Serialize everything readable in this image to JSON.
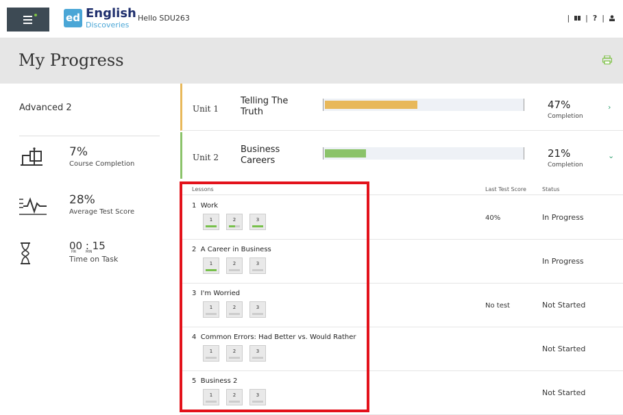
{
  "header": {
    "logo_badge": "ed",
    "logo_word": "English",
    "logo_sub": "Discoveries",
    "greeting": "Hello SDU263",
    "right_icons": [
      "book-icon",
      "help-icon",
      "user-icon"
    ],
    "help_label": "?"
  },
  "page": {
    "title": "My Progress"
  },
  "course": {
    "level": "Advanced 2",
    "course_completion": "7%",
    "course_completion_label": "Course Completion",
    "avg_score": "28%",
    "avg_score_label": "Average Test Score",
    "time_value": "00 : 15",
    "time_hr": "HR",
    "time_min": "MIN",
    "time_label": "Time on Task"
  },
  "units": [
    {
      "label": "Unit 1",
      "name": "Telling The Truth",
      "percent": "47%",
      "completion_label": "Completion",
      "progress": 0.47,
      "accent": "#e8b85a",
      "bar_color": "#e8b85a"
    },
    {
      "label": "Unit 2",
      "name": "Business Careers",
      "percent": "21%",
      "completion_label": "Completion",
      "progress": 0.21,
      "accent": "#8bc36a",
      "bar_color": "#8bc36a"
    }
  ],
  "lessons_table": {
    "headers": {
      "lessons": "Lessons",
      "last_test_score": "Last Test Score",
      "status": "Status"
    },
    "rows": [
      {
        "num": "1",
        "title": "Work",
        "score": "40%",
        "status": "In Progress",
        "steps": [
          "1",
          "2",
          "3"
        ],
        "done": [
          "done",
          "half",
          "done"
        ]
      },
      {
        "num": "2",
        "title": "A Career in Business",
        "score": "",
        "status": "In Progress",
        "steps": [
          "1",
          "2",
          "3"
        ],
        "done": [
          "done",
          "none",
          "none"
        ]
      },
      {
        "num": "3",
        "title": "I'm Worried",
        "score": "No test",
        "status": "Not Started",
        "steps": [
          "1",
          "2",
          "3"
        ],
        "done": [
          "none",
          "none",
          "none"
        ]
      },
      {
        "num": "4",
        "title": "Common Errors: Had Better vs. Would Rather",
        "score": "",
        "status": "Not Started",
        "steps": [
          "1",
          "2",
          "3"
        ],
        "done": [
          "none",
          "none",
          "none"
        ]
      },
      {
        "num": "5",
        "title": "Business 2",
        "score": "",
        "status": "Not Started",
        "steps": [
          "1",
          "2",
          "3"
        ],
        "done": [
          "none",
          "none",
          "none"
        ]
      }
    ]
  },
  "colors": {
    "menu_bg": "#3d4a54",
    "title_band": "#e6e6e6",
    "highlight": "#e3121b",
    "progress_green": "#77c04b",
    "brand_blue": "#4aa6d6"
  }
}
